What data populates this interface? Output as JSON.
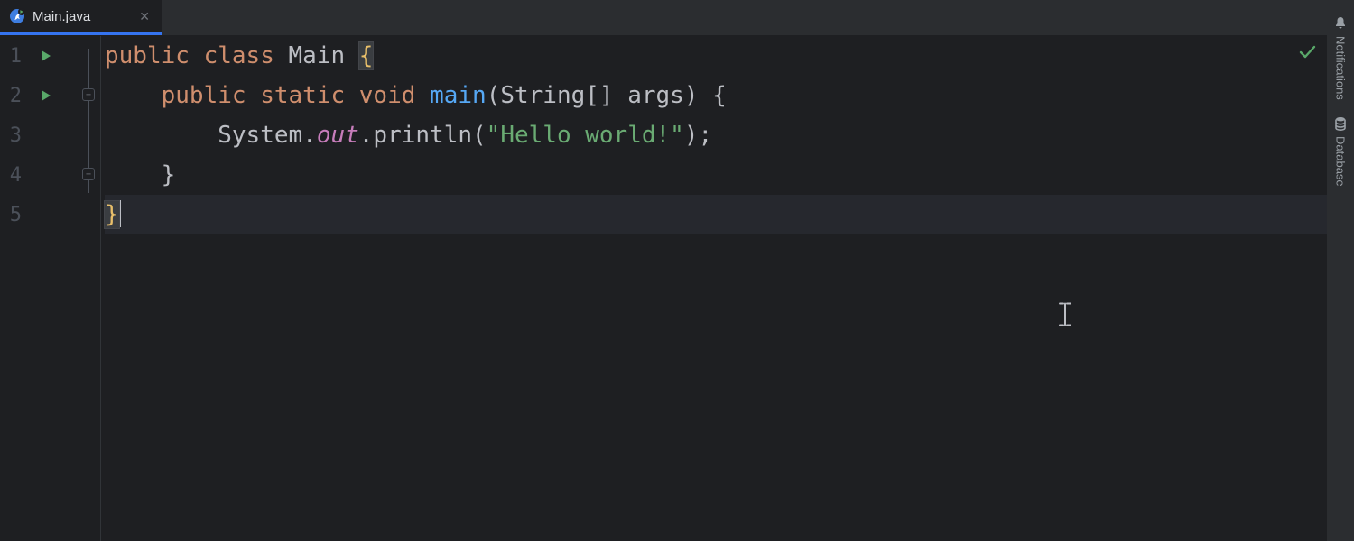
{
  "tab": {
    "label": "Main.java"
  },
  "rightTools": {
    "notifications": "Notifications",
    "database": "Database"
  },
  "lines": {
    "n1": "1",
    "n2": "2",
    "n3": "3",
    "n4": "4",
    "n5": "5"
  },
  "code": {
    "l1": {
      "kw1": "public",
      "kw2": "class",
      "cls": "Main",
      "ob": "{"
    },
    "l2": {
      "indent": "    ",
      "kw1": "public",
      "kw2": "static",
      "kw3": "void",
      "m": "main",
      "sig1": "(String[] args) ",
      "ob": "{"
    },
    "l3": {
      "indent": "        ",
      "sys": "System.",
      "out": "out",
      "call": ".println(",
      "str": "\"Hello world!\"",
      "end": ");"
    },
    "l4": {
      "indent": "    ",
      "cb": "}"
    },
    "l5": {
      "cb": "}"
    }
  }
}
